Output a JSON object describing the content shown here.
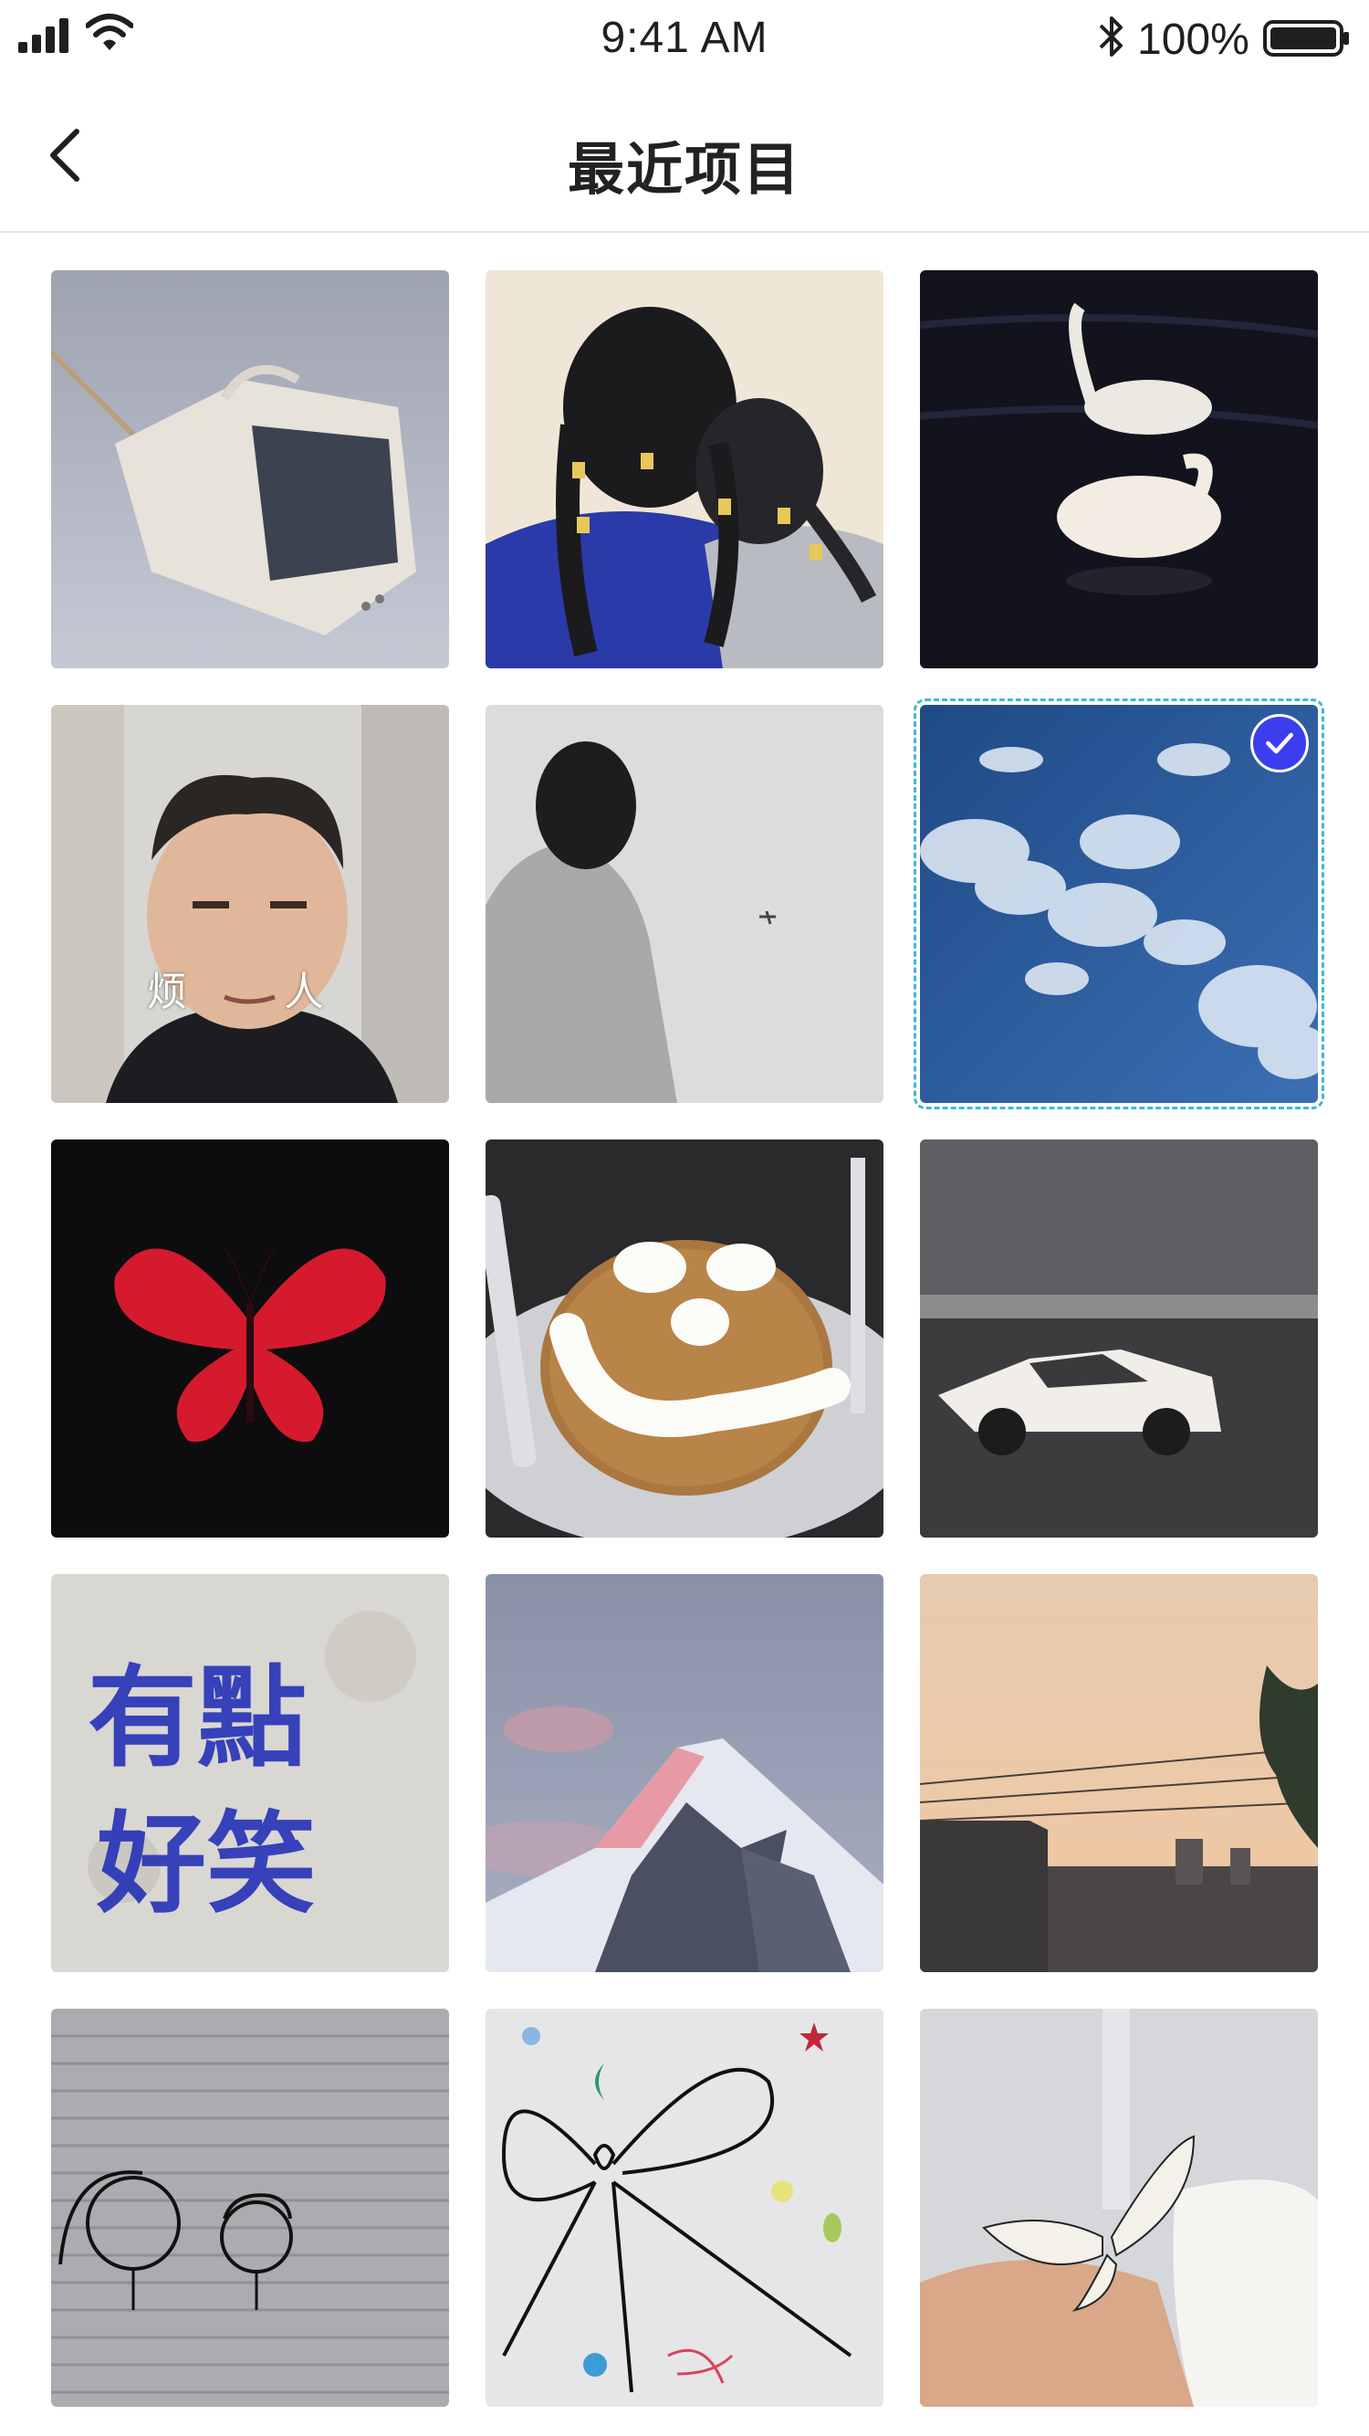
{
  "status_bar": {
    "time": "9:41 AM",
    "battery_percent": "100%"
  },
  "nav": {
    "title": "最近项目",
    "back_icon": "chevron-left-icon"
  },
  "colors": {
    "accent": "#3d3df0",
    "selection_outline": "#3fb9d8"
  },
  "photos": [
    {
      "subject": "vintage-tv",
      "selected": false
    },
    {
      "subject": "braided-hair",
      "selected": false
    },
    {
      "subject": "swans",
      "selected": false
    },
    {
      "subject": "man-meme",
      "selected": false,
      "caption_left": "烦",
      "caption_right": "人"
    },
    {
      "subject": "person-plane",
      "selected": false
    },
    {
      "subject": "blue-sky-clouds",
      "selected": true
    },
    {
      "subject": "red-butterfly",
      "selected": false
    },
    {
      "subject": "smiley-pancake",
      "selected": false
    },
    {
      "subject": "drawn-car",
      "selected": false
    },
    {
      "subject": "graffiti-wall",
      "selected": false,
      "line1": "有點",
      "line2": "好笑"
    },
    {
      "subject": "snowy-mountain",
      "selected": false
    },
    {
      "subject": "sunset-city",
      "selected": false
    },
    {
      "subject": "shutter-doodle",
      "selected": false
    },
    {
      "subject": "ribbon-drawing",
      "selected": false
    },
    {
      "subject": "white-butterfly",
      "selected": false
    }
  ]
}
